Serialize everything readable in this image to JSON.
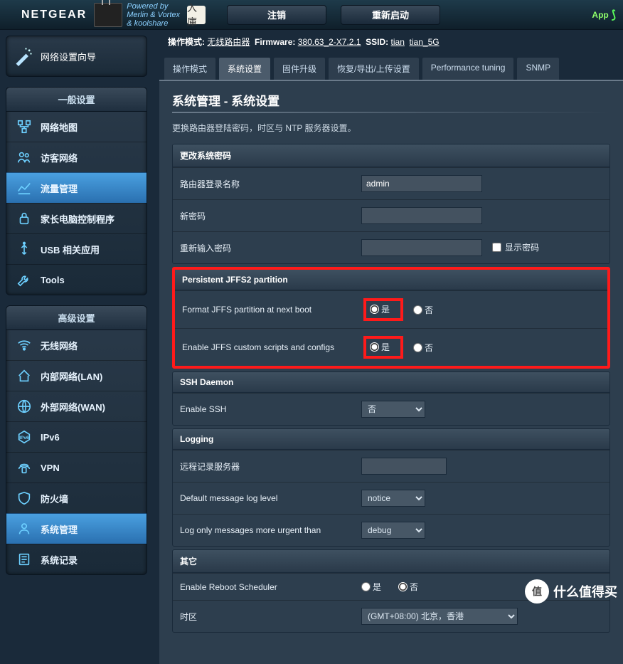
{
  "header": {
    "brand": "NETGEAR",
    "powered_l1": "Powered by",
    "powered_l2": "Merlin & Vortex",
    "powered_l3": "& koolshare",
    "seal": "入庫",
    "btn_logout": "注销",
    "btn_reboot": "重新启动",
    "app_label": "App"
  },
  "status": {
    "mode_label": "操作模式:",
    "mode_value": "无线路由器",
    "fw_label": "Firmware:",
    "fw_value": "380.63_2-X7.2.1",
    "ssid_label": "SSID:",
    "ssid1": "tian",
    "ssid2": "tian_5G"
  },
  "sidebar": {
    "wizard": "网络设置向导",
    "section1_title": "一般设置",
    "section2_title": "高级设置",
    "general": [
      {
        "label": "网络地图",
        "icon": "network-map"
      },
      {
        "label": "访客网络",
        "icon": "guest"
      },
      {
        "label": "流量管理",
        "icon": "traffic",
        "active": true
      },
      {
        "label": "家长电脑控制程序",
        "icon": "parental"
      },
      {
        "label": "USB 相关应用",
        "icon": "usb"
      },
      {
        "label": "Tools",
        "icon": "tools"
      }
    ],
    "advanced": [
      {
        "label": "无线网络",
        "icon": "wifi"
      },
      {
        "label": "内部网络(LAN)",
        "icon": "lan"
      },
      {
        "label": "外部网络(WAN)",
        "icon": "wan"
      },
      {
        "label": "IPv6",
        "icon": "ipv6"
      },
      {
        "label": "VPN",
        "icon": "vpn"
      },
      {
        "label": "防火墙",
        "icon": "firewall"
      },
      {
        "label": "系统管理",
        "icon": "admin",
        "active": true
      },
      {
        "label": "系统记录",
        "icon": "log"
      }
    ]
  },
  "tabs": [
    {
      "label": "操作模式",
      "id": "opmode"
    },
    {
      "label": "系统设置",
      "id": "sys",
      "active": true
    },
    {
      "label": "固件升级",
      "id": "fw"
    },
    {
      "label": "恢复/导出/上传设置",
      "id": "restore"
    },
    {
      "label": "Performance tuning",
      "id": "perf"
    },
    {
      "label": "SNMP",
      "id": "snmp"
    }
  ],
  "page": {
    "title": "系统管理 - 系统设置",
    "desc": "更换路由器登陆密码，时区与 NTP 服务器设置。"
  },
  "sections": {
    "password": {
      "title": "更改系统密码",
      "login_label": "路由器登录名称",
      "login_value": "admin",
      "newpw_label": "新密码",
      "retype_label": "重新输入密码",
      "showpw_label": "显示密码"
    },
    "jffs": {
      "title": "Persistent JFFS2 partition",
      "format_label": "Format JFFS partition at next boot",
      "enable_label": "Enable JFFS custom scripts and configs",
      "yes": "是",
      "no": "否"
    },
    "ssh": {
      "title": "SSH Daemon",
      "enable_label": "Enable SSH",
      "value": "否"
    },
    "logging": {
      "title": "Logging",
      "remote_label": "远程记录服务器",
      "default_level_label": "Default message log level",
      "default_level_value": "notice",
      "urgent_label": "Log only messages more urgent than",
      "urgent_value": "debug"
    },
    "misc": {
      "title": "其它",
      "reboot_label": "Enable Reboot Scheduler",
      "yes": "是",
      "no": "否",
      "tz_label": "时区",
      "tz_value": "(GMT+08:00) 北京，香港"
    }
  },
  "watermark": {
    "badge": "值",
    "text": "什么值得买"
  }
}
